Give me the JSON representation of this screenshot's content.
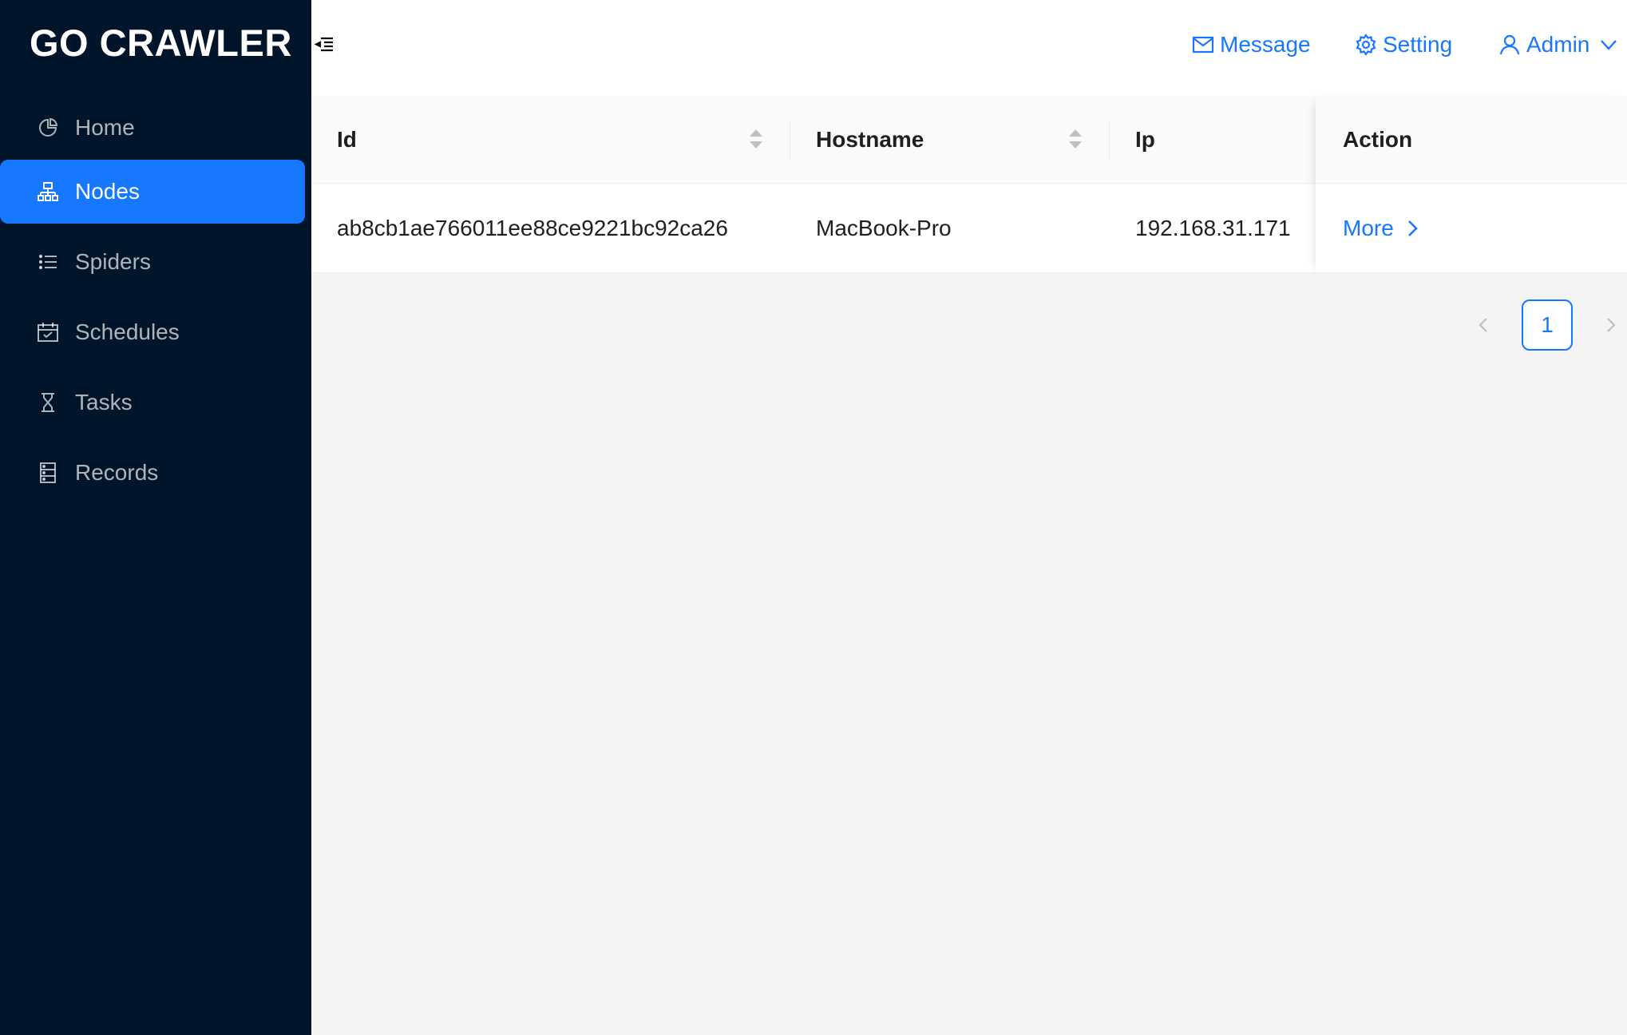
{
  "app": {
    "title": "GO CRAWLER"
  },
  "sidebar": {
    "items": [
      {
        "label": "Home",
        "icon": "pie-chart-icon"
      },
      {
        "label": "Nodes",
        "icon": "cluster-icon",
        "active": true
      },
      {
        "label": "Spiders",
        "icon": "unordered-list-icon"
      },
      {
        "label": "Schedules",
        "icon": "schedule-icon"
      },
      {
        "label": "Tasks",
        "icon": "hourglass-icon"
      },
      {
        "label": "Records",
        "icon": "database-icon"
      }
    ]
  },
  "header": {
    "fold_icon": "menu-fold-icon",
    "message_label": "Message",
    "setting_label": "Setting",
    "user_label": "Admin"
  },
  "table": {
    "columns": [
      {
        "label": "Id",
        "sortable": true
      },
      {
        "label": "Hostname",
        "sortable": true
      },
      {
        "label": "Ip",
        "sortable": false
      },
      {
        "label": "Action",
        "sortable": false
      }
    ],
    "rows": [
      {
        "id": "ab8cb1ae766011ee88ce9221bc92ca26",
        "hostname": "MacBook-Pro",
        "ip": "192.168.31.171",
        "action": "More"
      }
    ]
  },
  "pagination": {
    "current": "1"
  },
  "colors": {
    "sidebar_bg": "#001529",
    "accent": "#1677ff",
    "content_bg": "#f4f4f4"
  }
}
